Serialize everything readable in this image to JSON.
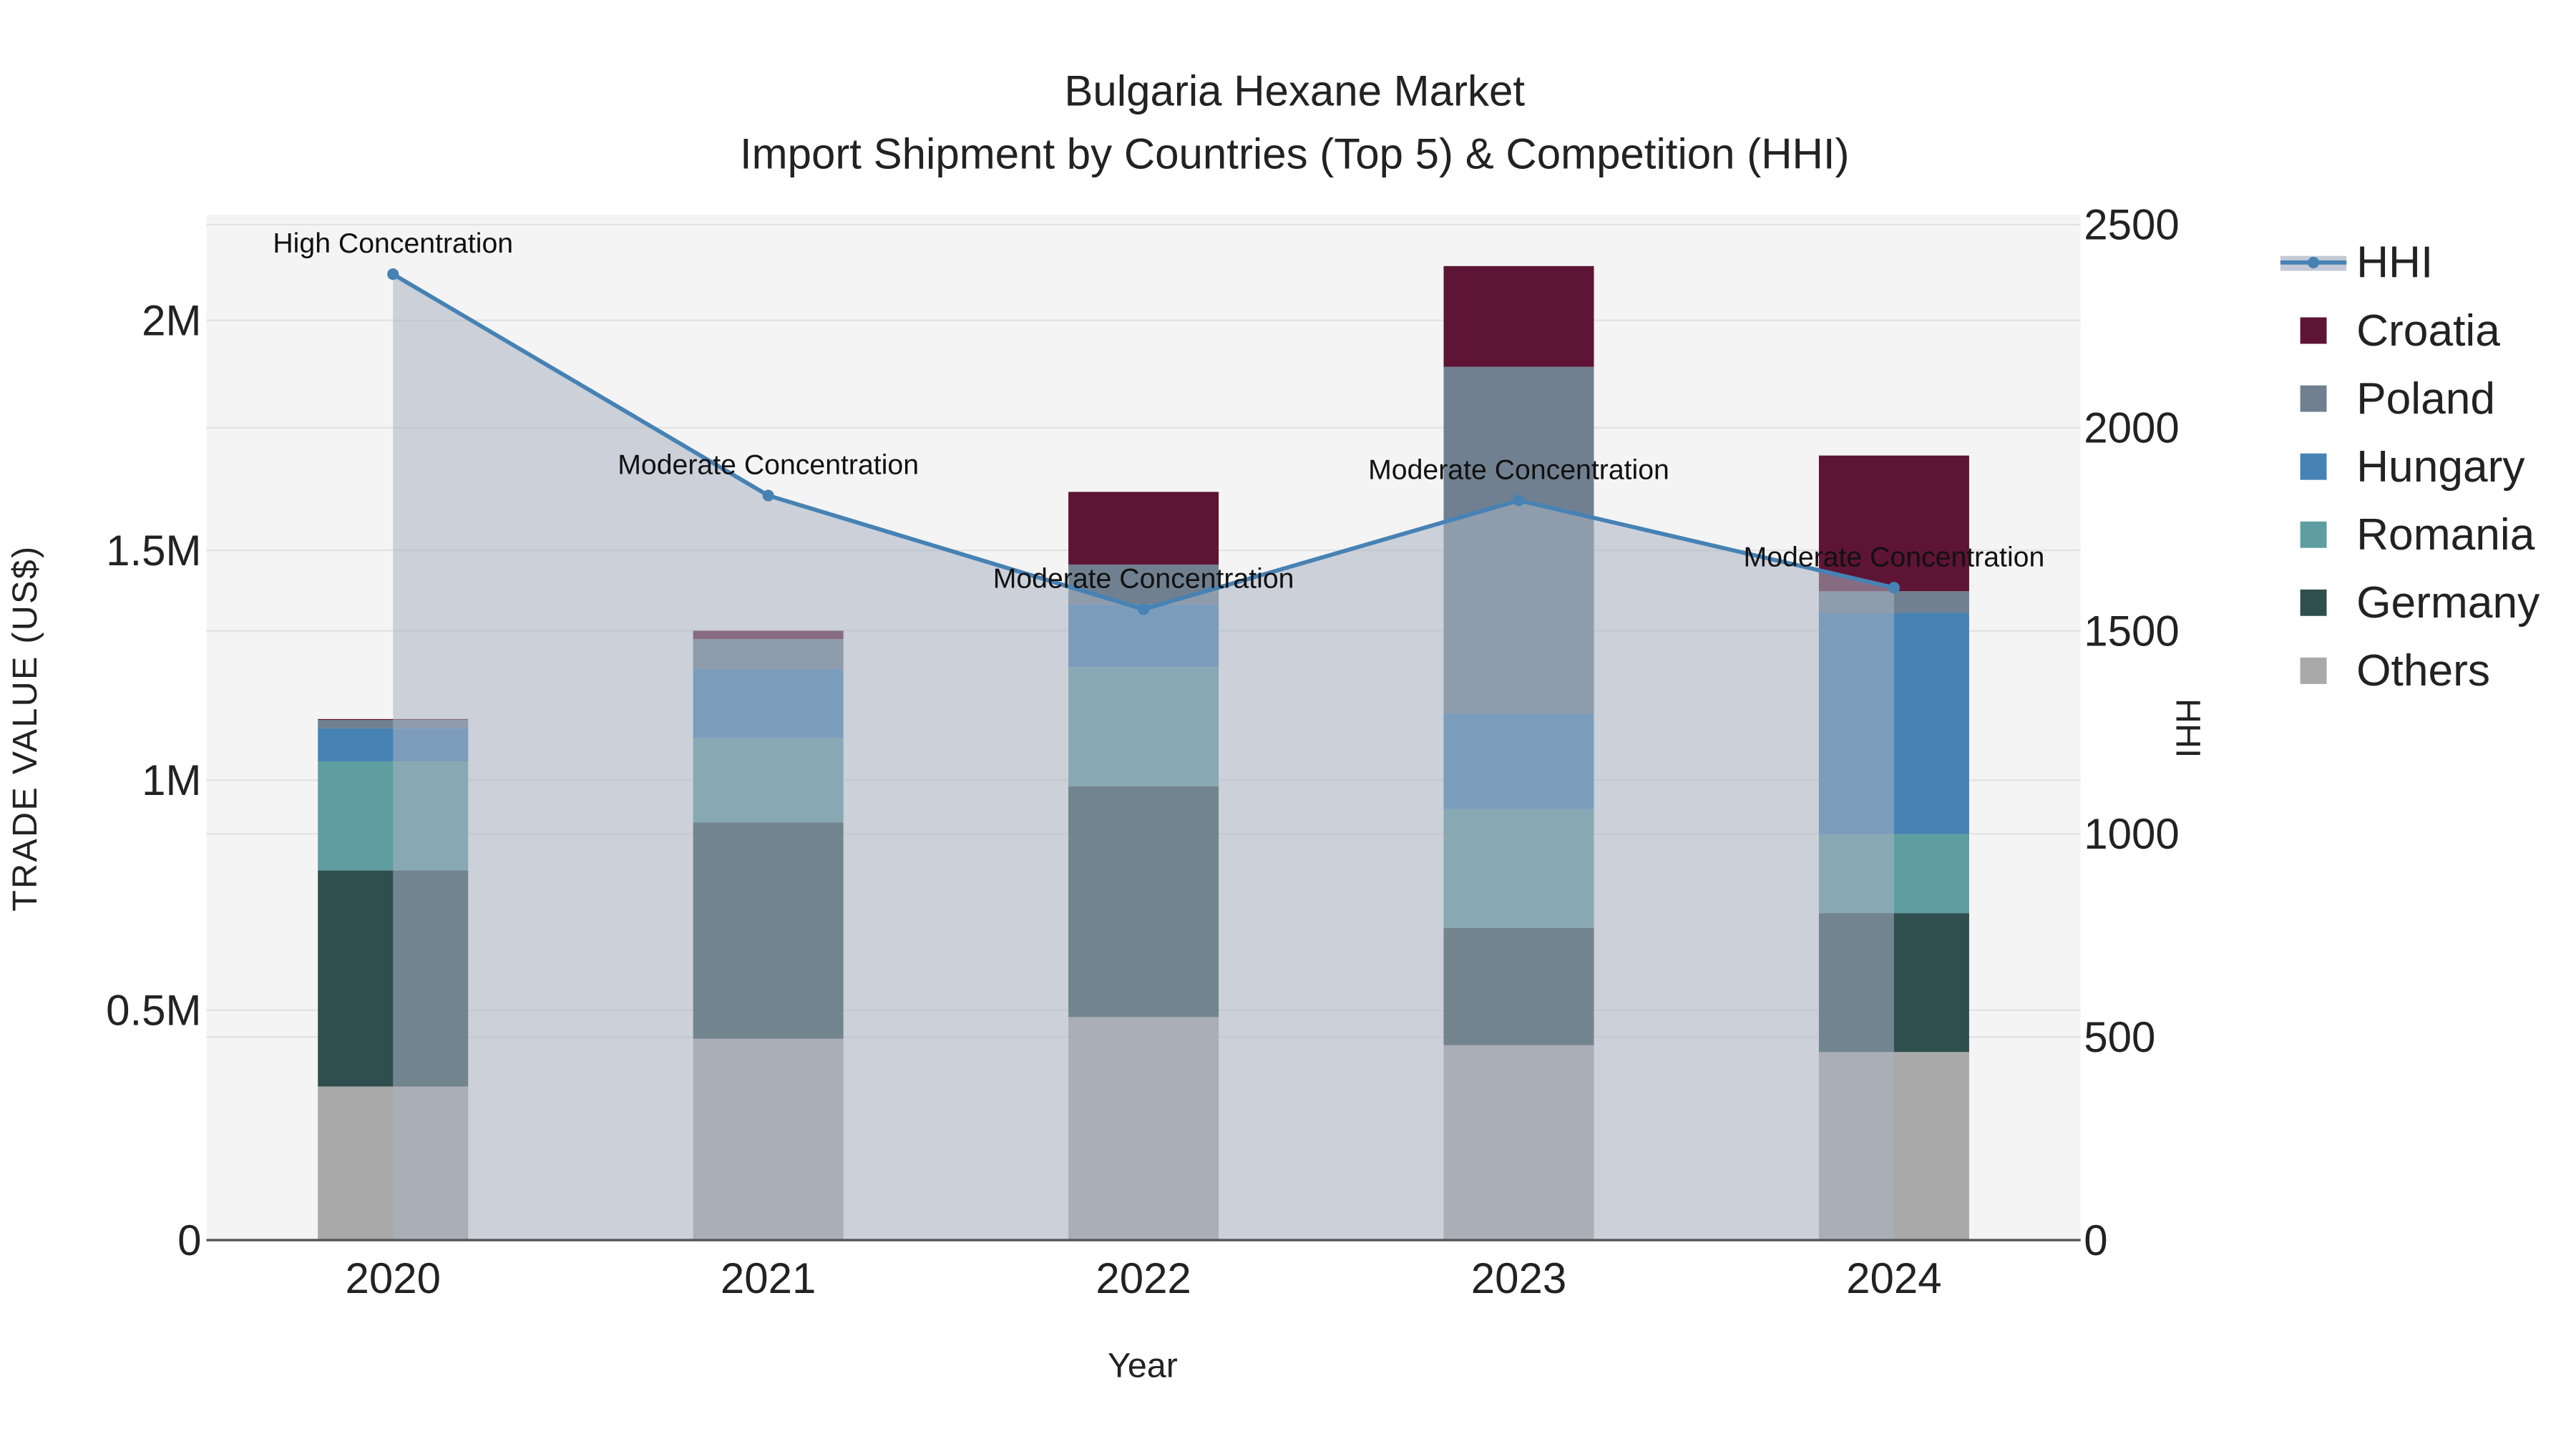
{
  "chart_data": {
    "type": "bar",
    "stacked": true,
    "title": "Bulgaria Hexane Market",
    "subtitle": "Import Shipment by Countries (Top 5) & Competition (HHI)",
    "xlabel": "Year",
    "ylabel": "TRADE VALUE (US$)",
    "y2label": "HHI",
    "categories": [
      "2020",
      "2021",
      "2022",
      "2023",
      "2024"
    ],
    "ylim": [
      0,
      2230000
    ],
    "y2lim": [
      0,
      2525
    ],
    "yticks": [
      {
        "v": 0,
        "label": "0"
      },
      {
        "v": 500000,
        "label": "0.5M"
      },
      {
        "v": 1000000,
        "label": "1M"
      },
      {
        "v": 1500000,
        "label": "1.5M"
      },
      {
        "v": 2000000,
        "label": "2M"
      }
    ],
    "y2ticks": [
      {
        "v": 0,
        "label": "0"
      },
      {
        "v": 500,
        "label": "500"
      },
      {
        "v": 1000,
        "label": "1000"
      },
      {
        "v": 1500,
        "label": "1500"
      },
      {
        "v": 2000,
        "label": "2000"
      },
      {
        "v": 2500,
        "label": "2500"
      }
    ],
    "series": [
      {
        "name": "Others",
        "color": "#a9a9a9",
        "values": [
          334000,
          438000,
          485000,
          424000,
          409000
        ]
      },
      {
        "name": "Germany",
        "color": "#2f4f4f",
        "values": [
          470000,
          470000,
          502000,
          255000,
          302000
        ]
      },
      {
        "name": "Romania",
        "color": "#5f9ea0",
        "values": [
          237000,
          184000,
          259000,
          258000,
          172000
        ]
      },
      {
        "name": "Hungary",
        "color": "#4682b4",
        "values": [
          72000,
          150000,
          136000,
          208000,
          481000
        ]
      },
      {
        "name": "Poland",
        "color": "#708090",
        "values": [
          18000,
          65000,
          87000,
          754000,
          47000
        ]
      },
      {
        "name": "Croatia",
        "color": "#5e1434",
        "values": [
          2000,
          18000,
          158000,
          219000,
          295000
        ]
      }
    ],
    "hhi": {
      "name": "HHI",
      "color": "#4682b4",
      "values": [
        2378,
        1833,
        1553,
        1821,
        1606
      ],
      "annotations": [
        "High Concentration",
        "Moderate Concentration",
        "Moderate Concentration",
        "Moderate Concentration",
        "Moderate Concentration"
      ]
    },
    "legend": {
      "position": "right",
      "order": [
        "HHI",
        "Croatia",
        "Poland",
        "Hungary",
        "Romania",
        "Germany",
        "Others"
      ]
    },
    "grid": true
  }
}
